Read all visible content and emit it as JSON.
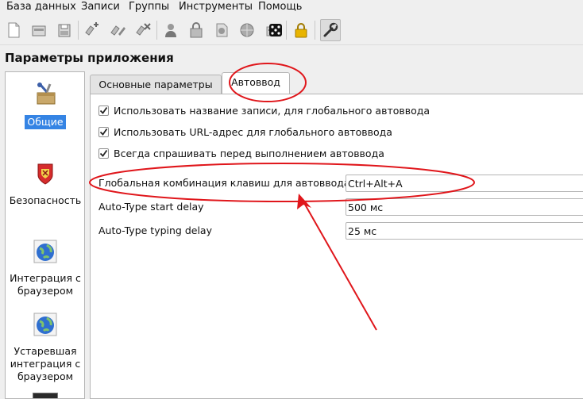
{
  "menu": [
    {
      "label": "База данных"
    },
    {
      "label": "Записи"
    },
    {
      "label": "Группы"
    },
    {
      "label": "Инструменты"
    },
    {
      "label": "Помощь"
    }
  ],
  "page_title": "Параметры приложения",
  "sidebar": {
    "items": [
      {
        "label": "Общие",
        "icon": "general-settings-icon"
      },
      {
        "label": "Безопасность",
        "icon": "security-shield-icon"
      },
      {
        "label": "Интеграция с браузером",
        "icon": "globe-icon"
      },
      {
        "label": "Устаревшая интеграция с браузером",
        "icon": "globe-icon"
      }
    ]
  },
  "tabs": [
    {
      "label": "Основные параметры",
      "active": false
    },
    {
      "label": "Автоввод",
      "active": true
    }
  ],
  "options": {
    "checkboxes": [
      {
        "label": "Использовать название записи, для глобального автоввода",
        "checked": true
      },
      {
        "label": "Использовать URL-адрес для глобального автоввода",
        "checked": true
      },
      {
        "label": "Всегда спрашивать перед выполнением автоввода",
        "checked": true
      }
    ],
    "fields": [
      {
        "label": "Глобальная комбинация клавиш для автоввода",
        "value": "Ctrl+Alt+A"
      },
      {
        "label": "Auto-Type start delay",
        "value": "500 мс"
      },
      {
        "label": "Auto-Type typing delay",
        "value": "25 мс"
      }
    ]
  },
  "colors": {
    "selection": "#3584e4",
    "annotation": "#e0161b"
  }
}
